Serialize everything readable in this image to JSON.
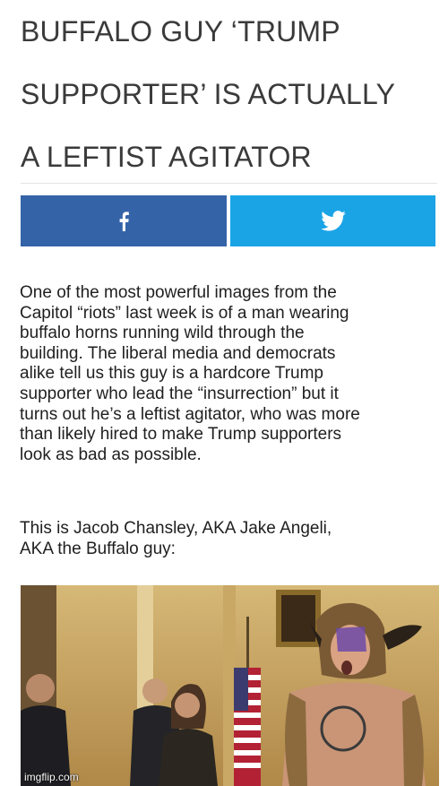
{
  "article": {
    "headline_lines": [
      "BUFFALO GUY ‘TRUMP",
      "SUPPORTER’ IS ACTUALLY",
      "A LEFTIST AGITATOR"
    ],
    "share": {
      "facebook_icon": "facebook-icon",
      "twitter_icon": "twitter-icon",
      "facebook_color": "#3463a8",
      "twitter_color": "#1aa4e6"
    },
    "paragraphs": [
      [
        "One of the most powerful images from the",
        "Capitol “riots” last week is of a man wearing",
        "buffalo horns running wild through the",
        "building. The liberal media and democrats",
        "alike tell us this guy is a hardcore Trump",
        "supporter who lead the “insurrection” but it",
        "turns out he’s a leftist agitator, who was more",
        "than likely hired to make Trump supporters",
        "look as bad as possible."
      ],
      [
        "This is Jacob Chansley, AKA Jake Angeli,",
        "AKA the Buffalo guy:"
      ]
    ]
  },
  "watermark": "imgflip.com"
}
